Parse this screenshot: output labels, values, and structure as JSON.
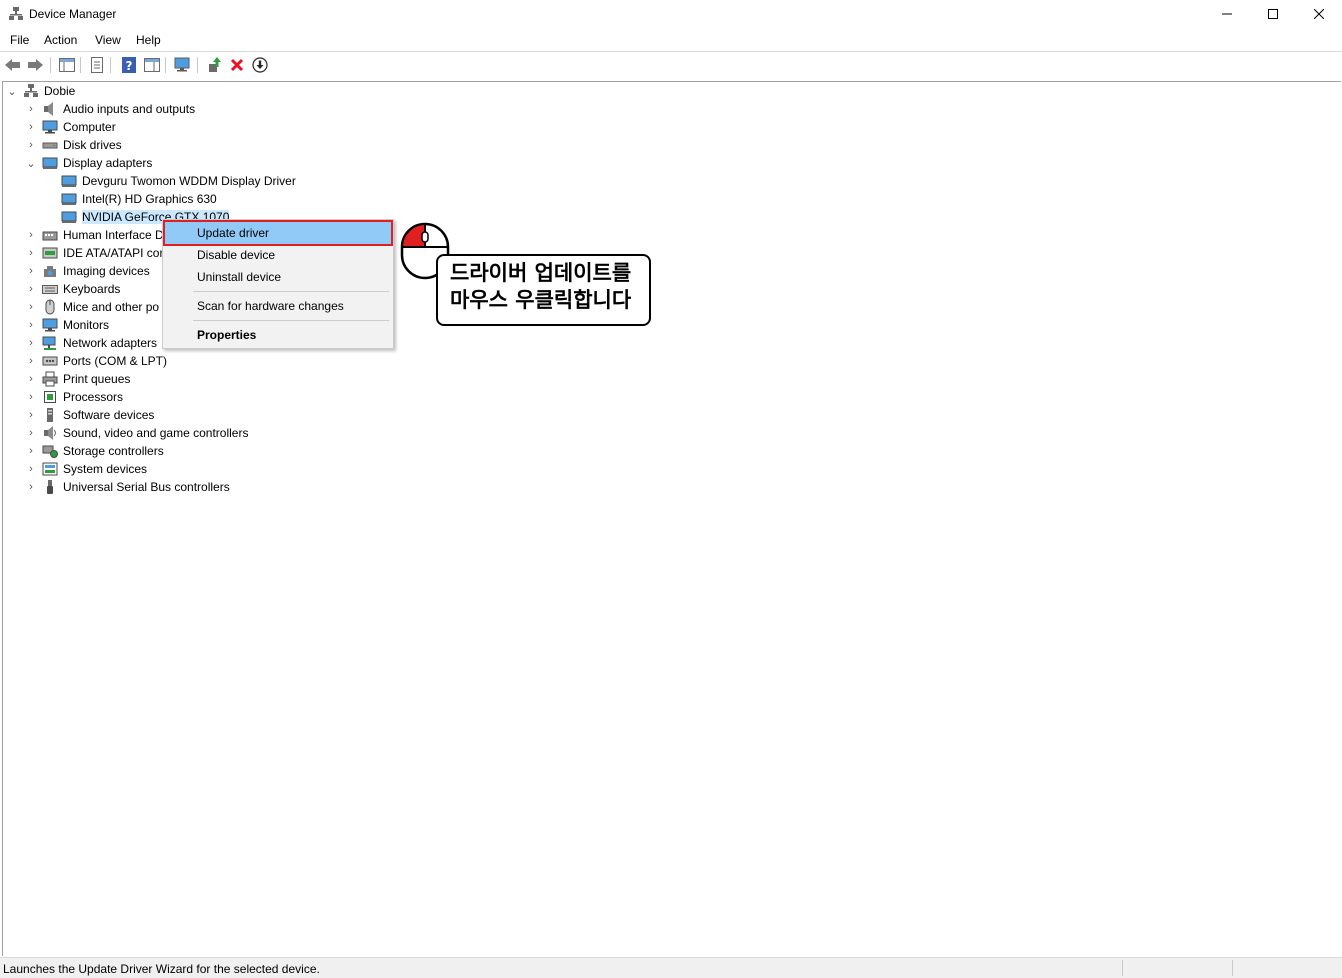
{
  "window": {
    "title": "Device Manager"
  },
  "menu": [
    "File",
    "Action",
    "View",
    "Help"
  ],
  "tree": {
    "root": "Dobie",
    "categories": [
      "Audio inputs and outputs",
      "Computer",
      "Disk drives",
      "Display adapters",
      "Human Interface D",
      "IDE ATA/ATAPI con",
      "Imaging devices",
      "Keyboards",
      "Mice and other po",
      "Monitors",
      "Network adapters",
      "Ports (COM & LPT)",
      "Print queues",
      "Processors",
      "Software devices",
      "Sound, video and game controllers",
      "Storage controllers",
      "System devices",
      "Universal Serial Bus controllers"
    ],
    "display_children": [
      "Devguru Twomon WDDM Display Driver",
      "Intel(R) HD Graphics 630",
      "NVIDIA GeForce GTX 1070"
    ]
  },
  "context_menu": {
    "update": "Update driver",
    "disable": "Disable device",
    "uninstall": "Uninstall device",
    "scan": "Scan for hardware changes",
    "properties": "Properties"
  },
  "callout": {
    "line1": "드라이버 업데이트를",
    "line2": "마우스 우클릭합니다"
  },
  "status": {
    "text": "Launches the Update Driver Wizard for the selected device."
  },
  "colors": {
    "selection": "#cce8ff",
    "menu_highlight": "#91c9f7",
    "annotation_red": "#e02020",
    "delete_red": "#e81123"
  }
}
